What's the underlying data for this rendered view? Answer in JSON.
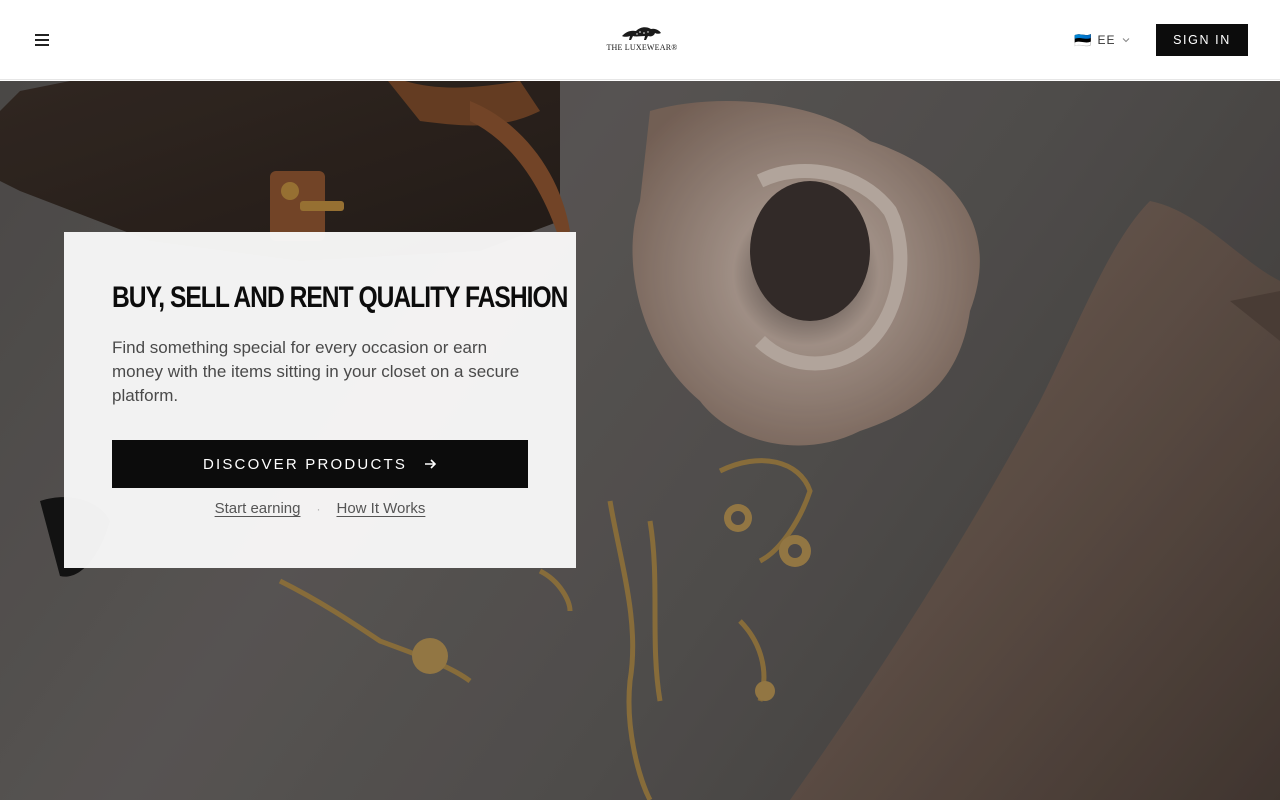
{
  "header": {
    "logo_text": "THE LUXEWEAR®",
    "language": {
      "flag": "🇪🇪",
      "code": "EE"
    },
    "sign_in_label": "SIGN IN"
  },
  "hero": {
    "title": "BUY, SELL AND RENT QUALITY FASHION",
    "description": "Find something special for every occasion or earn money with the items sitting in your closet on a secure platform.",
    "cta_label": "DISCOVER PRODUCTS",
    "links": {
      "start_earning": "Start earning",
      "separator": "·",
      "how_it_works": "How It Works"
    }
  },
  "icons": {
    "menu": "hamburger-icon",
    "chevron": "chevron-down-icon",
    "arrow": "arrow-right-icon"
  },
  "colors": {
    "primary_button": "#0c0c0c",
    "card_background": "#f8f8f8",
    "body_text": "#4a4a4a"
  }
}
